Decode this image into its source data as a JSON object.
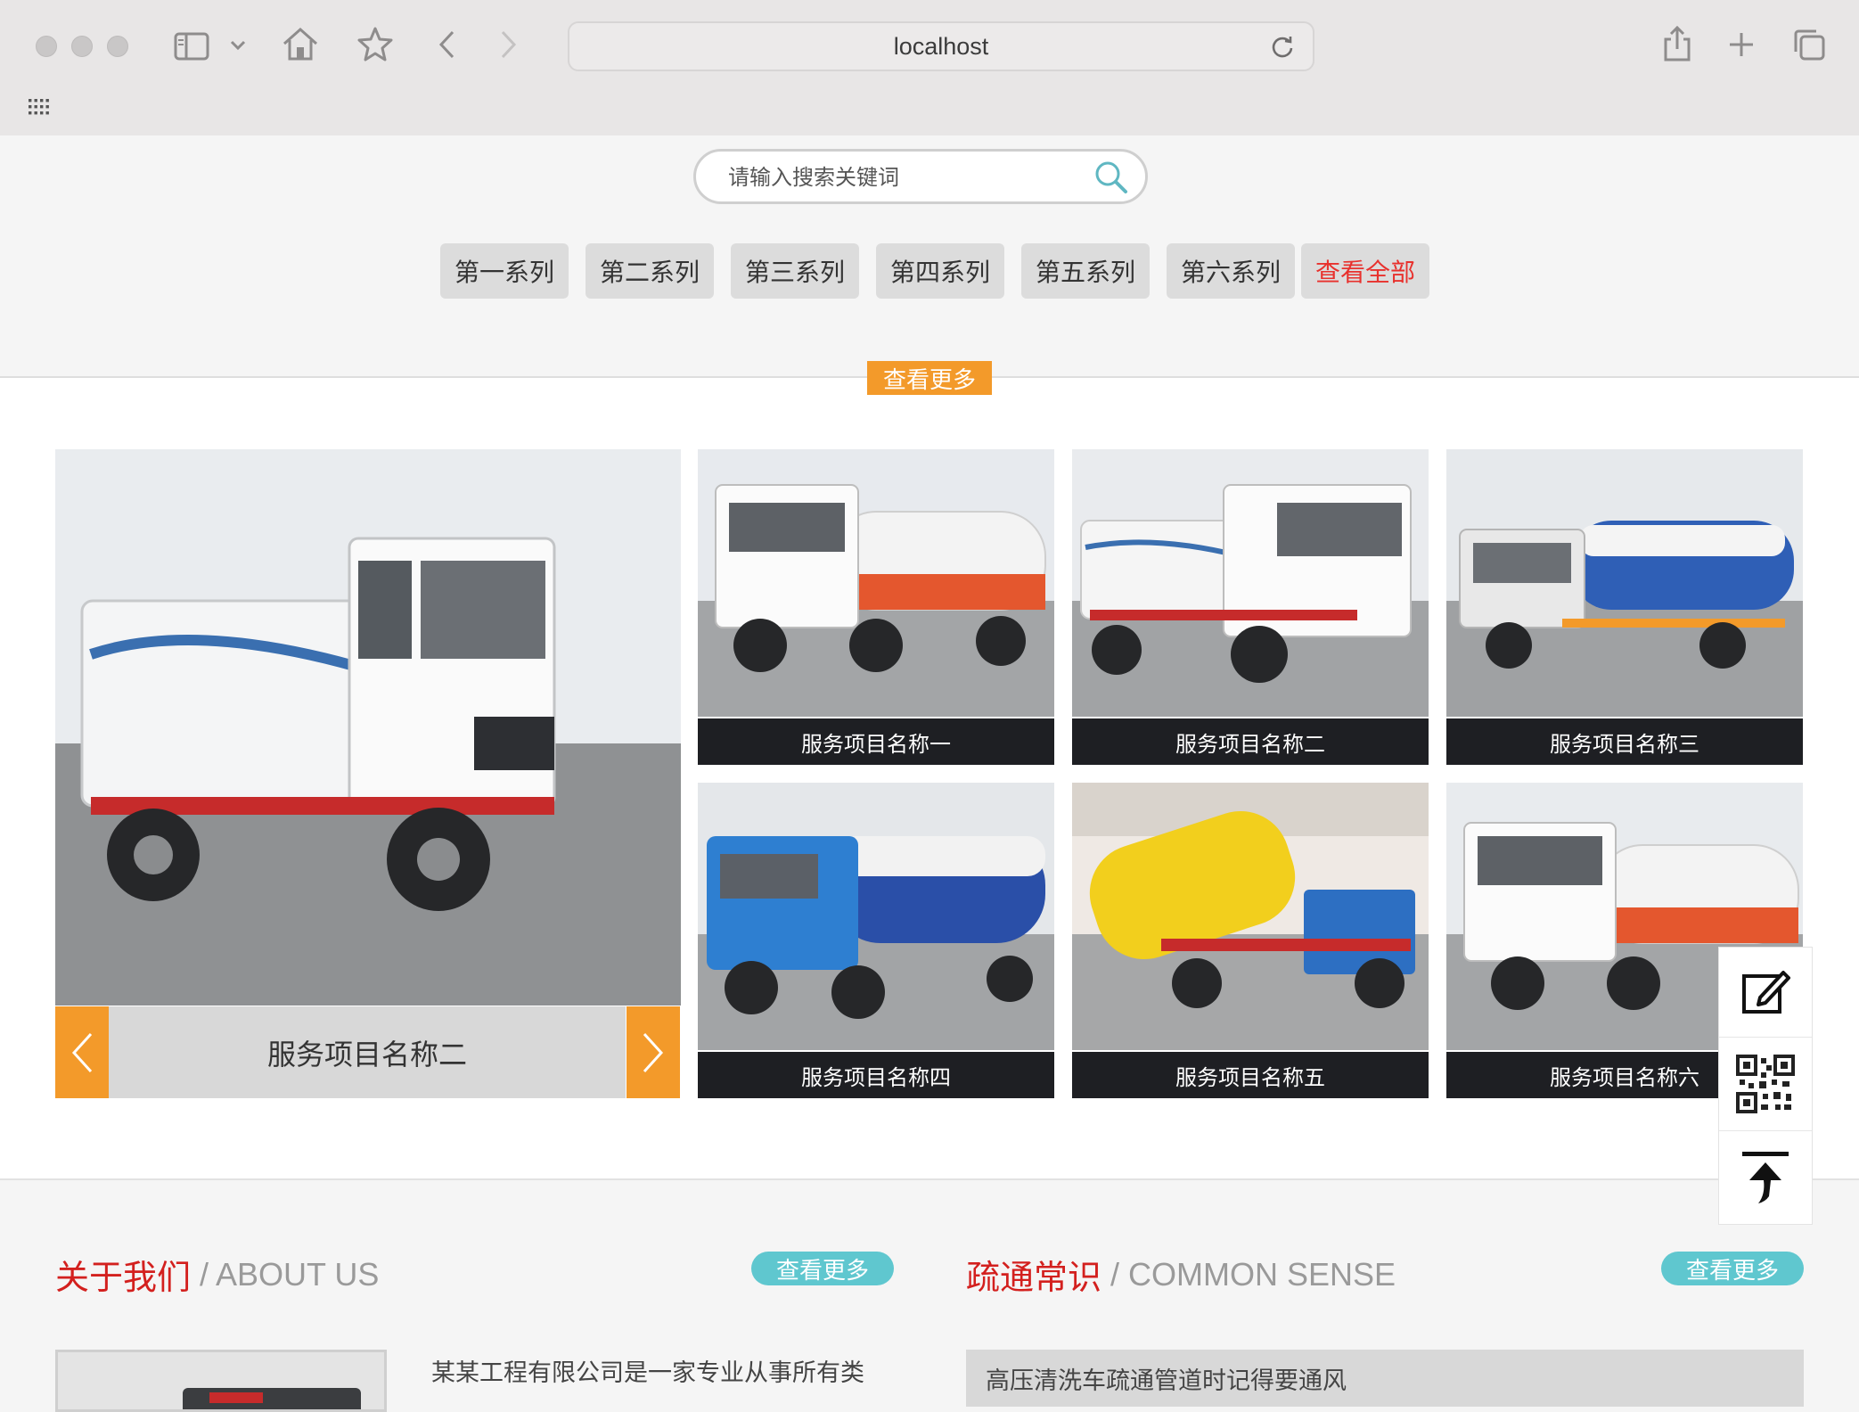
{
  "browser": {
    "url": "localhost"
  },
  "search": {
    "placeholder": "请输入搜索关键词"
  },
  "series_nav": {
    "items": [
      "第一系列",
      "第二系列",
      "第三系列",
      "第四系列",
      "第五系列",
      "第六系列"
    ],
    "view_all": "查看全部",
    "view_all_color": "#e8312d"
  },
  "products": {
    "more_label": "查看更多",
    "slider_caption": "服务项目名称二",
    "items": [
      {
        "name": "服务项目名称一"
      },
      {
        "name": "服务项目名称二"
      },
      {
        "name": "服务项目名称三"
      },
      {
        "name": "服务项目名称四"
      },
      {
        "name": "服务项目名称五"
      },
      {
        "name": "服务项目名称六"
      }
    ]
  },
  "about": {
    "title_cn": "关于我们",
    "title_en": "/ ABOUT US",
    "more_label": "查看更多",
    "intro": "某某工程有限公司是一家专业从事所有类"
  },
  "sense": {
    "title_cn": "疏通常识",
    "title_en": "/ COMMON SENSE",
    "more_label": "查看更多",
    "first_article": "高压清洗车疏通管道时记得要通风"
  },
  "colors": {
    "accent_orange": "#f39a2a",
    "accent_red": "#d3201e",
    "accent_teal": "#5fc7cf",
    "caption_bg": "#1e1f23"
  }
}
